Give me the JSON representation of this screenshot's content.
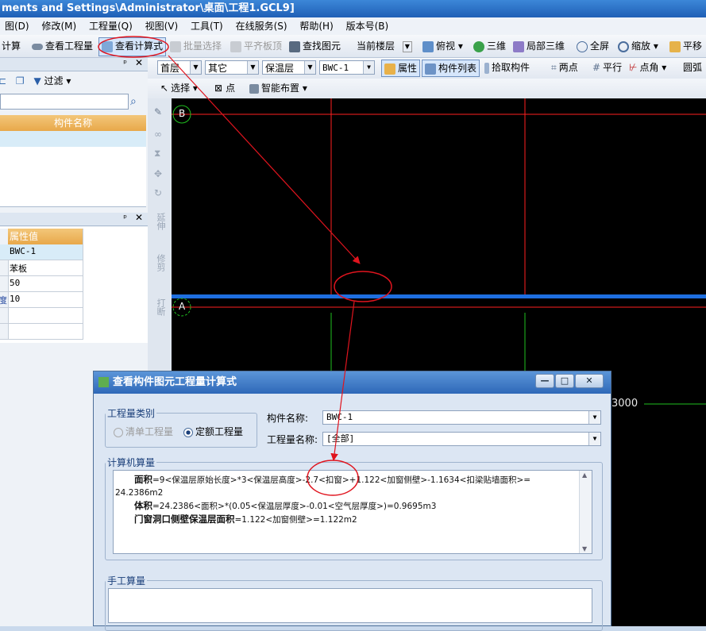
{
  "window": {
    "title": "ments and Settings\\Administrator\\桌面\\工程1.GCL9]"
  },
  "menu": {
    "items": [
      "图(D)",
      "修改(M)",
      "工程量(Q)",
      "视图(V)",
      "工具(T)",
      "在线服务(S)",
      "帮助(H)",
      "版本号(B)"
    ]
  },
  "toolbar1": {
    "calc": "计算",
    "view_quantity": "查看工程量",
    "view_formula": "查看计算式",
    "batch_select": "批量选择",
    "level_slab": "平齐板顶",
    "find_element": "查找图元",
    "current_floor": "当前楼层",
    "top_view": "俯视",
    "three_d": "三维",
    "local_3d": "局部三维",
    "fullscreen": "全屏",
    "zoom": "缩放",
    "pan": "平移"
  },
  "toolbar2": {
    "floor": "首层",
    "category": "其它",
    "layer": "保温层",
    "component": "BWC-1",
    "properties": "属性",
    "component_list": "构件列表",
    "pick_component": "拾取构件",
    "two_points": "两点",
    "parallel": "平行",
    "point_angle": "点角",
    "circle_arc": "圆弧"
  },
  "toolbar3": {
    "select": "选择",
    "point": "点",
    "smart_layout": "智能布置"
  },
  "left_panel": {
    "filter": "过滤",
    "list_header": "构件名称",
    "prop_header": "属性值",
    "props": [
      "BWC-1",
      "苯板",
      "50",
      "10",
      "",
      ""
    ],
    "prop_side_label": "度"
  },
  "vertical_tools": [
    "延伸",
    "修剪",
    "打断"
  ],
  "canvas": {
    "axis_b": "B",
    "axis_a": "A",
    "dimension": "3000"
  },
  "dialog": {
    "title": "查看构件图元工程量计算式",
    "group_type": "工程量类别",
    "radio_bill": "清单工程量",
    "radio_quota": "定额工程量",
    "radio_selected": "quota",
    "component_name_label": "构件名称:",
    "component_name_value": "BWC-1",
    "quantity_name_label": "工程量名称:",
    "quantity_name_value": "[全部]",
    "computer_calc_label": "计算机算量",
    "calc_lines": [
      {
        "name": "面积",
        "expr": "=9<保温层原始长度>*3<保温层高度>-2.7<扣窗>+1.122<加窗侧壁>-1.1634<扣梁贴墙面积>="
      },
      {
        "name": "",
        "expr": "24.2386m2"
      },
      {
        "name": "体积",
        "expr": "=24.2386<面积>*(0.05<保温层厚度>-0.01<空气层厚度>)=0.9695m3"
      },
      {
        "name": "门窗洞口侧壁保温层面积",
        "expr": "=1.122<加窗侧壁>=1.122m2"
      }
    ],
    "manual_calc_label": "手工算量"
  },
  "colors": {
    "annotation": "#e0141e",
    "title_blue": "#2466b8",
    "canvas_bg": "#000000",
    "axis_red": "#ff2020",
    "axis_green": "#20c020"
  }
}
